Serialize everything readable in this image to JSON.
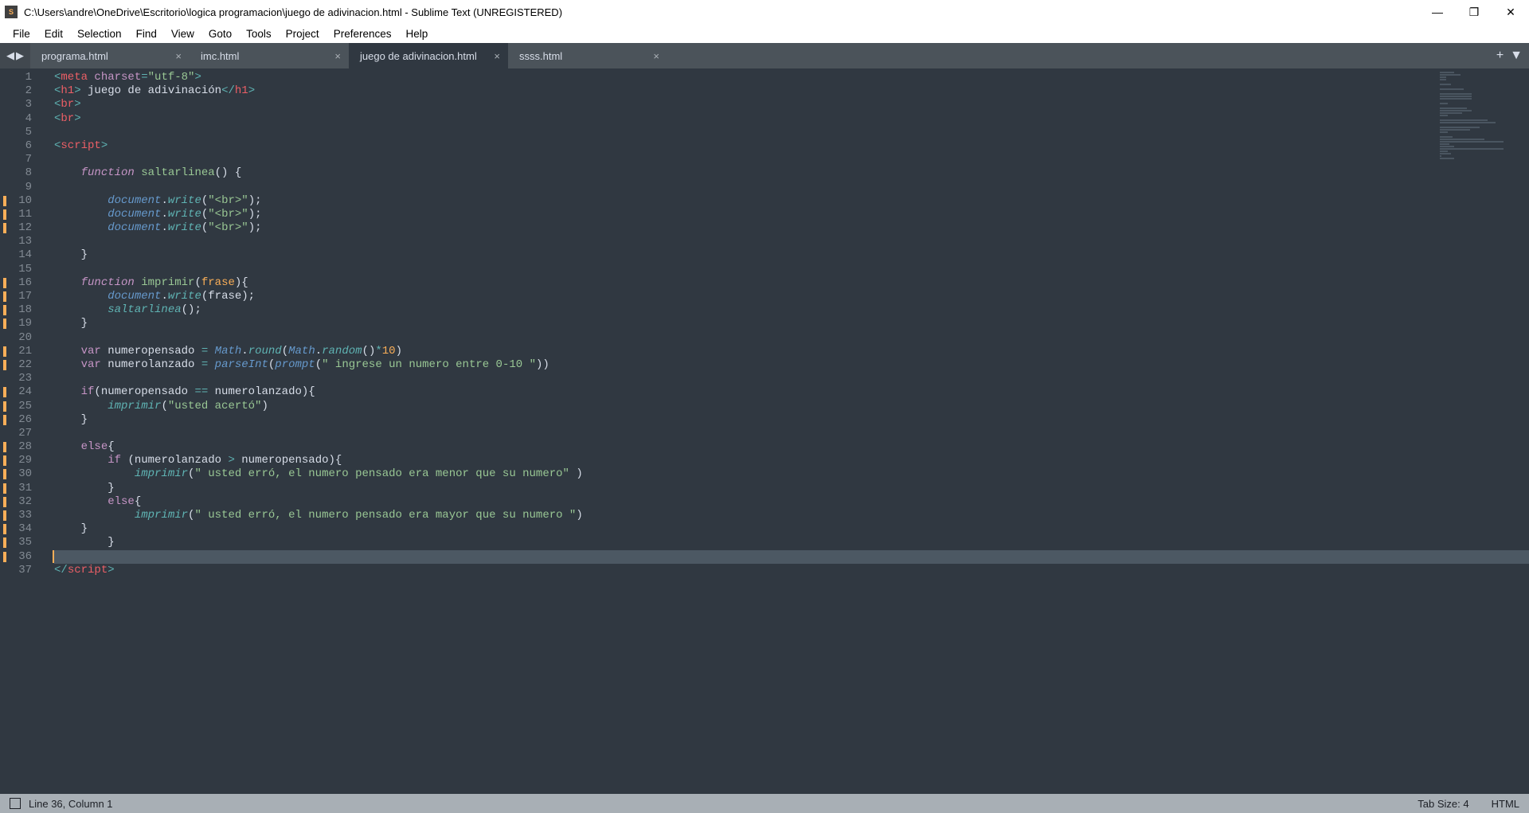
{
  "window": {
    "title": "C:\\Users\\andre\\OneDrive\\Escritorio\\logica programacion\\juego de adivinacion.html - Sublime Text (UNREGISTERED)"
  },
  "menu": [
    "File",
    "Edit",
    "Selection",
    "Find",
    "View",
    "Goto",
    "Tools",
    "Project",
    "Preferences",
    "Help"
  ],
  "tabs": [
    {
      "label": "programa.html",
      "active": false
    },
    {
      "label": "imc.html",
      "active": false
    },
    {
      "label": "juego de adivinacion.html",
      "active": true
    },
    {
      "label": "ssss.html",
      "active": false
    }
  ],
  "gutter": {
    "lines": 37,
    "modified": [
      10,
      11,
      12,
      16,
      17,
      18,
      19,
      21,
      22,
      24,
      25,
      26,
      28,
      29,
      30,
      31,
      32,
      33,
      34,
      35,
      36
    ],
    "current": 36
  },
  "code": {
    "l1": {
      "pre": "",
      "open": "<",
      "tag": "meta",
      "sp": " ",
      "attr": "charset",
      "eq": "=",
      "str": "\"utf-8\"",
      "close": ">"
    },
    "l2": {
      "open": "<",
      "tag": "h1",
      "close": ">",
      "txt": " juego de adivinación",
      "open2": "</",
      "tag2": "h1",
      "close2": ">"
    },
    "l3": {
      "open": "<",
      "tag": "br",
      "close": ">"
    },
    "l4": {
      "open": "<",
      "tag": "br",
      "close": ">"
    },
    "l6": {
      "open": "<",
      "tag": "script",
      "close": ">"
    },
    "l8": {
      "kw": "function",
      "sp": " ",
      "name": "saltarlinea",
      "paren": "() {"
    },
    "l10": {
      "obj": "document",
      "dot": ".",
      "fn": "write",
      "open": "(",
      "str": "\"<br>\"",
      "close": ");"
    },
    "l11": {
      "obj": "document",
      "dot": ".",
      "fn": "write",
      "open": "(",
      "str": "\"<br>\"",
      "close": ");"
    },
    "l12": {
      "obj": "document",
      "dot": ".",
      "fn": "write",
      "open": "(",
      "str": "\"<br>\"",
      "close": ");"
    },
    "l14": {
      "brace": "}"
    },
    "l16": {
      "kw": "function",
      "sp": " ",
      "name": "imprimir",
      "open": "(",
      "param": "frase",
      "close": "){"
    },
    "l17": {
      "obj": "document",
      "dot": ".",
      "fn": "write",
      "open": "(",
      "arg": "frase",
      "close": ");"
    },
    "l18": {
      "fn": "saltarlinea",
      "call": "();"
    },
    "l19": {
      "brace": "}"
    },
    "l21": {
      "kw": "var",
      "sp": " ",
      "name": "numeropensado",
      "eq": " = ",
      "obj": "Math",
      "dot": ".",
      "fn": "round",
      "open": "(",
      "obj2": "Math",
      "dot2": ".",
      "fn2": "random",
      "call": "()",
      "op": "*",
      "num": "10",
      "close": ")"
    },
    "l22": {
      "kw": "var",
      "sp": " ",
      "name": "numerolanzado",
      "eq": " = ",
      "fn": "parseInt",
      "open": "(",
      "fn2": "prompt",
      "open2": "(",
      "str": "\" ingrese un numero entre 0-10 \"",
      "close": "))"
    },
    "l24": {
      "kw": "if",
      "open": "(",
      "a": "numeropensado",
      "op": " == ",
      "b": "numerolanzado",
      "close": "){"
    },
    "l25": {
      "fn": "imprimir",
      "open": "(",
      "str": "\"usted acertó\"",
      "close": ")"
    },
    "l26": {
      "brace": "}"
    },
    "l28": {
      "kw": "else",
      "brace": "{"
    },
    "l29": {
      "kw": "if",
      "sp": " ",
      "open": "(",
      "a": "numerolanzado",
      "op": " > ",
      "b": "numeropensado",
      "close": "){"
    },
    "l30": {
      "fn": "imprimir",
      "open": "(",
      "str": "\" usted erró, el numero pensado era menor que su numero\"",
      "close": " )"
    },
    "l31": {
      "brace": "}"
    },
    "l32": {
      "kw": "else",
      "brace": "{"
    },
    "l33": {
      "fn": "imprimir",
      "open": "(",
      "str": "\" usted erró, el numero pensado era mayor que su numero \"",
      "close": ")"
    },
    "l34": {
      "brace": "}"
    },
    "l35": {
      "brace": "}"
    },
    "l37": {
      "open": "</",
      "tag": "script",
      "close": ">"
    }
  },
  "status": {
    "linecol": "Line 36, Column 1",
    "tabsize": "Tab Size: 4",
    "syntax": "HTML"
  }
}
